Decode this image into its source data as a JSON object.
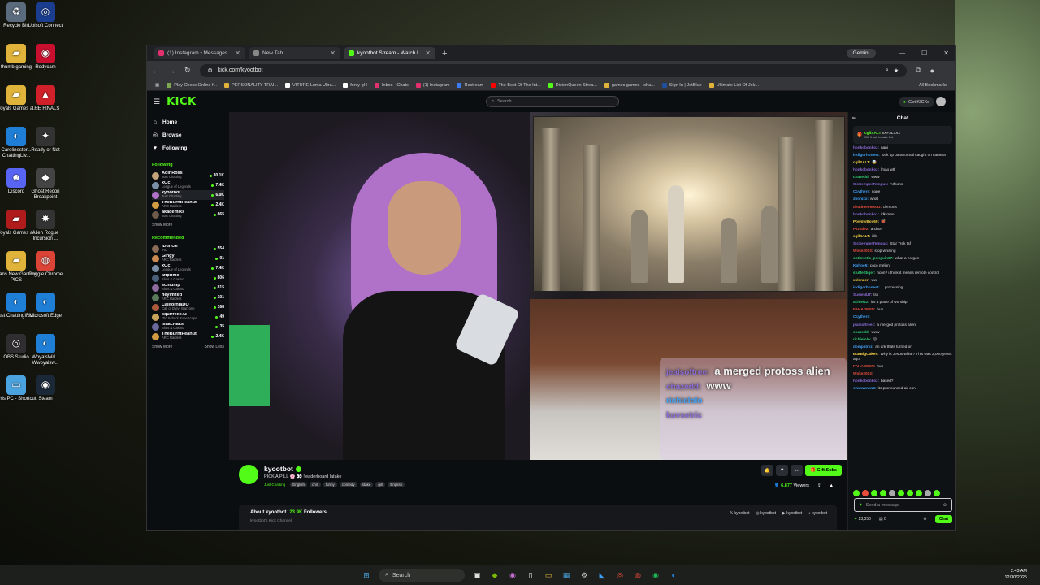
{
  "desktop": {
    "icons": [
      {
        "label": "Recycle Bin",
        "icon": "recycle-bin-icon",
        "color": "#5a6b7d"
      },
      {
        "label": "Ubisoft Connect",
        "icon": "ubisoft-icon",
        "color": "#1a3d8f"
      },
      {
        "label": "thumb gaming",
        "icon": "folder-icon",
        "color": "#e0b33a"
      },
      {
        "label": "Rodycam",
        "icon": "rodycam-icon",
        "color": "#c8102e"
      },
      {
        "label": "Woyals Games a...",
        "icon": "folder-icon",
        "color": "#e0b33a"
      },
      {
        "label": "THE FINALS",
        "icon": "the-finals-icon",
        "color": "#d0202a"
      },
      {
        "label": "Carolinestor... ChattingLiv...",
        "icon": "edge-icon",
        "color": "#1f7ed6"
      },
      {
        "label": "Ready or Not",
        "icon": "ready-or-not-icon",
        "color": "#333333"
      },
      {
        "label": "Discord",
        "icon": "discord-icon",
        "color": "#5865f2"
      },
      {
        "label": "Ghost Recon Breakpoint",
        "icon": "ghost-recon-icon",
        "color": "#444444"
      },
      {
        "label": "Woyals Games a...",
        "icon": "folder-icon",
        "color": "#b01c1c"
      },
      {
        "label": "Alien Rogue Incursion ...",
        "icon": "alien-rogue-icon",
        "color": "#333333"
      },
      {
        "label": "Dans New Gaming PICS",
        "icon": "folder-icon",
        "color": "#e0b33a"
      },
      {
        "label": "Google Chrome",
        "icon": "chrome-icon",
        "color": "#db4437"
      },
      {
        "label": "Just ChattingIRL...",
        "icon": "edge-icon",
        "color": "#1f7ed6"
      },
      {
        "label": "Microsoft Edge",
        "icon": "edge-icon",
        "color": "#1f7ed6"
      },
      {
        "label": "OBS Studio",
        "icon": "obs-icon",
        "color": "#302e31"
      },
      {
        "label": "WoyalsWd... Wwoyalsw...",
        "icon": "edge-icon",
        "color": "#1f7ed6"
      },
      {
        "label": "This PC - Shortcut",
        "icon": "this-pc-icon",
        "color": "#4aa3df"
      },
      {
        "label": "Steam",
        "icon": "steam-icon",
        "color": "#1b2838"
      }
    ]
  },
  "browser": {
    "tabs": [
      {
        "title": "(1) Instagram • Messages",
        "color": "#e1306c"
      },
      {
        "title": "New Tab",
        "color": "#888888"
      },
      {
        "title": "kyootbot Stream - Watch l",
        "color": "#53fc18"
      }
    ],
    "gemini_label": "Gemini",
    "url": "kick.com/kyootbot",
    "bookmarks": [
      {
        "label": "Play Chess Online f...",
        "color": "#7fa650"
      },
      {
        "label": "PERSONALITY TRAI...",
        "color": "#e0b33a"
      },
      {
        "label": "VITURE Luma Ultra...",
        "color": "#ffffff"
      },
      {
        "label": "fenty gl4",
        "color": "#ffffff"
      },
      {
        "label": "Inbox - Chats",
        "color": "#e1306c"
      },
      {
        "label": "(1) Instagram",
        "color": "#e1306c"
      },
      {
        "label": "Restream",
        "color": "#3c7bf0"
      },
      {
        "label": "The Best Of The Int...",
        "color": "#ff0000"
      },
      {
        "label": "DicienQueen Strea...",
        "color": "#53fc18"
      },
      {
        "label": "games games - sha...",
        "color": "#e0b33a"
      },
      {
        "label": "Sign In | JetBlue",
        "color": "#1f4e9c"
      },
      {
        "label": "Ultimate List Of Jok...",
        "color": "#e0b33a"
      }
    ],
    "all_bookmarks": "All Bookmarks"
  },
  "kick": {
    "logo": "KICK",
    "search_placeholder": "Search",
    "get_kicks": "Get KICKs",
    "nav": [
      {
        "label": "Home",
        "icon": "home-icon"
      },
      {
        "label": "Browse",
        "icon": "browse-icon"
      },
      {
        "label": "Following",
        "icon": "heart-icon"
      }
    ],
    "following_title": "Following",
    "following": [
      {
        "name": "AdinRoss",
        "category": "Just Chatting",
        "viewers": "30.1K",
        "color": "#c4a27a"
      },
      {
        "name": "xQc",
        "category": "League of Legends",
        "viewers": "7.4K",
        "color": "#7a8fa8"
      },
      {
        "name": "kyootbot",
        "category": "Just Chatting",
        "viewers": "6.9K",
        "color": "#b071c9"
      },
      {
        "name": "TheBurntPeanut",
        "category": "ARC Raiders",
        "viewers": "2.4K",
        "color": "#d29b42"
      },
      {
        "name": "akademiks",
        "category": "Just Chatting",
        "viewers": "865",
        "color": "#6d5a4a"
      }
    ],
    "show_more": "Show More",
    "recommended_title": "Recommended",
    "recommended": [
      {
        "name": "iDuncle",
        "category": "IRL",
        "viewers": "554",
        "color": "#8a6b55"
      },
      {
        "name": "Gingy",
        "category": "ARC Raiders",
        "viewers": "91",
        "color": "#c98a52"
      },
      {
        "name": "xQc",
        "category": "League of Legends",
        "viewers": "7.4K",
        "color": "#7a8fa8"
      },
      {
        "name": "tztprime",
        "category": "Slots & Casino",
        "viewers": "806",
        "color": "#4a5f7a"
      },
      {
        "name": "schlump",
        "category": "Slots & Casino",
        "viewers": "815",
        "color": "#8f6b9e"
      },
      {
        "name": "heyimzed",
        "category": "ARC Raiders",
        "viewers": "101",
        "color": "#5a7a5a"
      },
      {
        "name": "CaliforniaDO",
        "category": "Call of Duty: Warzone",
        "viewers": "168",
        "color": "#a85a3a"
      },
      {
        "name": "squirrelie73",
        "category": "Old School RuneScape",
        "viewers": "49",
        "color": "#c9a35a"
      },
      {
        "name": "IsaacNaks",
        "category": "Slots & Casino",
        "viewers": "35",
        "color": "#6a6a9e"
      },
      {
        "name": "TheBurntPeanut",
        "category": "ARC Raiders",
        "viewers": "2.4K",
        "color": "#d29b42"
      }
    ],
    "show_more_2": "Show More",
    "show_less": "Show Less",
    "overlay": [
      {
        "user": "jealsoftree:",
        "text": "a merged protoss alien"
      },
      {
        "user": "chazedd:",
        "text": "www"
      },
      {
        "user": "richielolo",
        "text": ""
      },
      {
        "user": "kuvsetric",
        "text": ""
      }
    ],
    "streamer": {
      "name": "kyootbot",
      "title": "PICK A PILL 🌸 👀 !leaderboard latake",
      "category": "Just Chatting",
      "tags": [
        "English",
        "chill",
        "funny",
        "comedy",
        "stake",
        "girl",
        "English"
      ],
      "gift_subs": "Gift Subs",
      "viewers": "6,877",
      "viewers_label": "Viewers"
    },
    "about": {
      "title": "About kyootbot",
      "followers": "23.9K",
      "followers_label": "Followers",
      "subtitle": "kyootbot's Kick Channel",
      "socials": [
        "kyootbot",
        "kyootbot",
        "kyootbot",
        "kyootbot"
      ]
    },
    "chat": {
      "title": "Chat",
      "pinned_user": "cgllSALT",
      "pinned_target": "xXF3L1Xx",
      "pinned_sub": "Gift 1 sub to take 3rd",
      "messages": [
        {
          "user": "honkobonkoz:",
          "text": "nani",
          "color": "#8b6bd6"
        },
        {
          "user": "indigorhonest:",
          "text": "look up paranormal caught on camera",
          "color": "#3fa0f5"
        },
        {
          "user": "cgllSALT:",
          "text": "🤯",
          "color": "#f5d142"
        },
        {
          "user": "honkobonkoz:",
          "text": "lmao wtf",
          "color": "#8b6bd6"
        },
        {
          "user": "chazedd:",
          "text": "www",
          "color": "#2ecc71"
        },
        {
          "user": "SicSemperTempus:",
          "text": "AIfoons",
          "color": "#8b6bd6"
        },
        {
          "user": "Ccytherr:",
          "text": "nope",
          "color": "#3fa0f5"
        },
        {
          "user": "zhonixx:",
          "text": "what",
          "color": "#3fa0f5"
        },
        {
          "user": "deadmemestaz:",
          "text": "demons",
          "color": "#e74c3c"
        },
        {
          "user": "honkobonkoz:",
          "text": "idk man",
          "color": "#8b6bd6"
        },
        {
          "user": "PowmyBoy69:",
          "text": "👹",
          "color": "#f5d142"
        },
        {
          "user": "Pzzsdez:",
          "text": "archon",
          "color": "#e74c3c"
        },
        {
          "user": "cgllSALT:",
          "text": "idk",
          "color": "#f5d142"
        },
        {
          "user": "SicSemperTempus:",
          "text": "Star Trek taf",
          "color": "#8b6bd6"
        },
        {
          "user": "Woke2003:",
          "text": "stop whining",
          "color": "#e74c3c"
        },
        {
          "user": "optimistic_penguin07:",
          "text": "what a zorgon",
          "color": "#2ecc71"
        },
        {
          "user": "Kphoe5:",
          "text": "coco melon",
          "color": "#3fa0f5"
        },
        {
          "user": "stuffedtiger:",
          "text": "ncon? i think it means remote control",
          "color": "#2ecc71"
        },
        {
          "user": "xxlenzer:",
          "text": "ww",
          "color": "#f5d142"
        },
        {
          "user": "indigorhonest:",
          "text": "...processing...",
          "color": "#3fa0f5"
        },
        {
          "user": "SusieNUT:",
          "text": "tsk",
          "color": "#8b6bd6"
        },
        {
          "user": "achiefzz:",
          "text": "it's a place of worship",
          "color": "#2ecc71"
        },
        {
          "user": "FAHADEEN:",
          "text": "huh",
          "color": "#e74c3c"
        },
        {
          "user": "Ccytherr:",
          "text": "",
          "color": "#3fa0f5"
        },
        {
          "user": "jealsoftreez:",
          "text": "a merged protoss alien",
          "color": "#8b6bd6"
        },
        {
          "user": "chazedd:",
          "text": "www",
          "color": "#2ecc71"
        },
        {
          "user": "richielolo:",
          "text": "😐",
          "color": "#2ecc71"
        },
        {
          "user": "dompatrkz:",
          "text": "an ark thats turned on",
          "color": "#3fa0f5"
        },
        {
          "user": "IEatBigCakes:",
          "text": "Why is Jesus white? This was 2,000 years ago.",
          "color": "#f5d142"
        },
        {
          "user": "FAHADEEN:",
          "text": "huh",
          "color": "#e74c3c"
        },
        {
          "user": "Woke2003:",
          "text": "",
          "color": "#e74c3c"
        },
        {
          "user": "honkobonkoz:",
          "text": "based?",
          "color": "#8b6bd6"
        },
        {
          "user": "swwwwww5:",
          "text": "its pronounced air con",
          "color": "#3fa0f5"
        }
      ],
      "input_placeholder": "Send a message",
      "points": "23,350",
      "tickets": "0",
      "send_label": "Chat"
    }
  },
  "taskbar": {
    "search": "Search",
    "time": "2:43 AM",
    "date": "12/30/2025"
  }
}
